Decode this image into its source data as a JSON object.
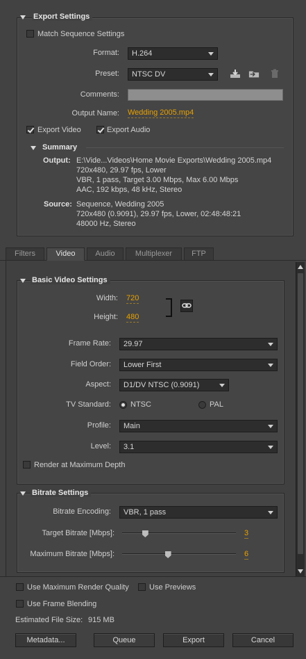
{
  "export_settings": {
    "header": "Export Settings",
    "match_sequence_label": "Match Sequence Settings",
    "format_label": "Format:",
    "format_value": "H.264",
    "preset_label": "Preset:",
    "preset_value": "NTSC DV",
    "comments_label": "Comments:",
    "comments_value": "",
    "output_name_label": "Output Name:",
    "output_name_value": "Wedding 2005.mp4",
    "export_video_label": "Export Video",
    "export_audio_label": "Export Audio",
    "export_video_checked": true,
    "export_audio_checked": true,
    "match_sequence_checked": false
  },
  "summary": {
    "header": "Summary",
    "output_label": "Output:",
    "output_lines": [
      "E:\\Vide...Videos\\Home Movie Exports\\Wedding 2005.mp4",
      "720x480, 29.97 fps, Lower",
      "VBR, 1 pass, Target 3.00 Mbps, Max 6.00 Mbps",
      "AAC, 192 kbps, 48 kHz, Stereo"
    ],
    "source_label": "Source:",
    "source_lines": [
      "Sequence, Wedding 2005",
      "720x480 (0.9091), 29.97 fps, Lower, 02:48:48:21",
      "48000 Hz, Stereo"
    ]
  },
  "tabs": [
    "Filters",
    "Video",
    "Audio",
    "Multiplexer",
    "FTP"
  ],
  "active_tab": "Video",
  "basic_video": {
    "header": "Basic Video Settings",
    "width_label": "Width:",
    "width_value": "720",
    "height_label": "Height:",
    "height_value": "480",
    "frame_rate_label": "Frame Rate:",
    "frame_rate_value": "29.97",
    "field_order_label": "Field Order:",
    "field_order_value": "Lower First",
    "aspect_label": "Aspect:",
    "aspect_value": "D1/DV NTSC (0.9091)",
    "tv_standard_label": "TV Standard:",
    "ntsc_label": "NTSC",
    "pal_label": "PAL",
    "tv_standard_selected": "NTSC",
    "profile_label": "Profile:",
    "profile_value": "Main",
    "level_label": "Level:",
    "level_value": "3.1",
    "render_max_depth_label": "Render at Maximum Depth",
    "render_max_depth_checked": false
  },
  "bitrate": {
    "header": "Bitrate Settings",
    "encoding_label": "Bitrate Encoding:",
    "encoding_value": "VBR, 1 pass",
    "target_label": "Target Bitrate [Mbps]:",
    "target_value": "3",
    "target_fraction": 0.2,
    "max_label": "Maximum Bitrate [Mbps]:",
    "max_value": "6",
    "max_fraction": 0.4
  },
  "bottom": {
    "max_render_quality_label": "Use Maximum Render Quality",
    "use_previews_label": "Use Previews",
    "frame_blending_label": "Use Frame Blending",
    "file_size_label": "Estimated File Size:",
    "file_size_value": "915 MB",
    "metadata_button": "Metadata...",
    "queue_button": "Queue",
    "export_button": "Export",
    "cancel_button": "Cancel"
  },
  "colors": {
    "accent_link": "#e8a100",
    "background": "#424242",
    "field_bg": "#2d2d2d"
  }
}
